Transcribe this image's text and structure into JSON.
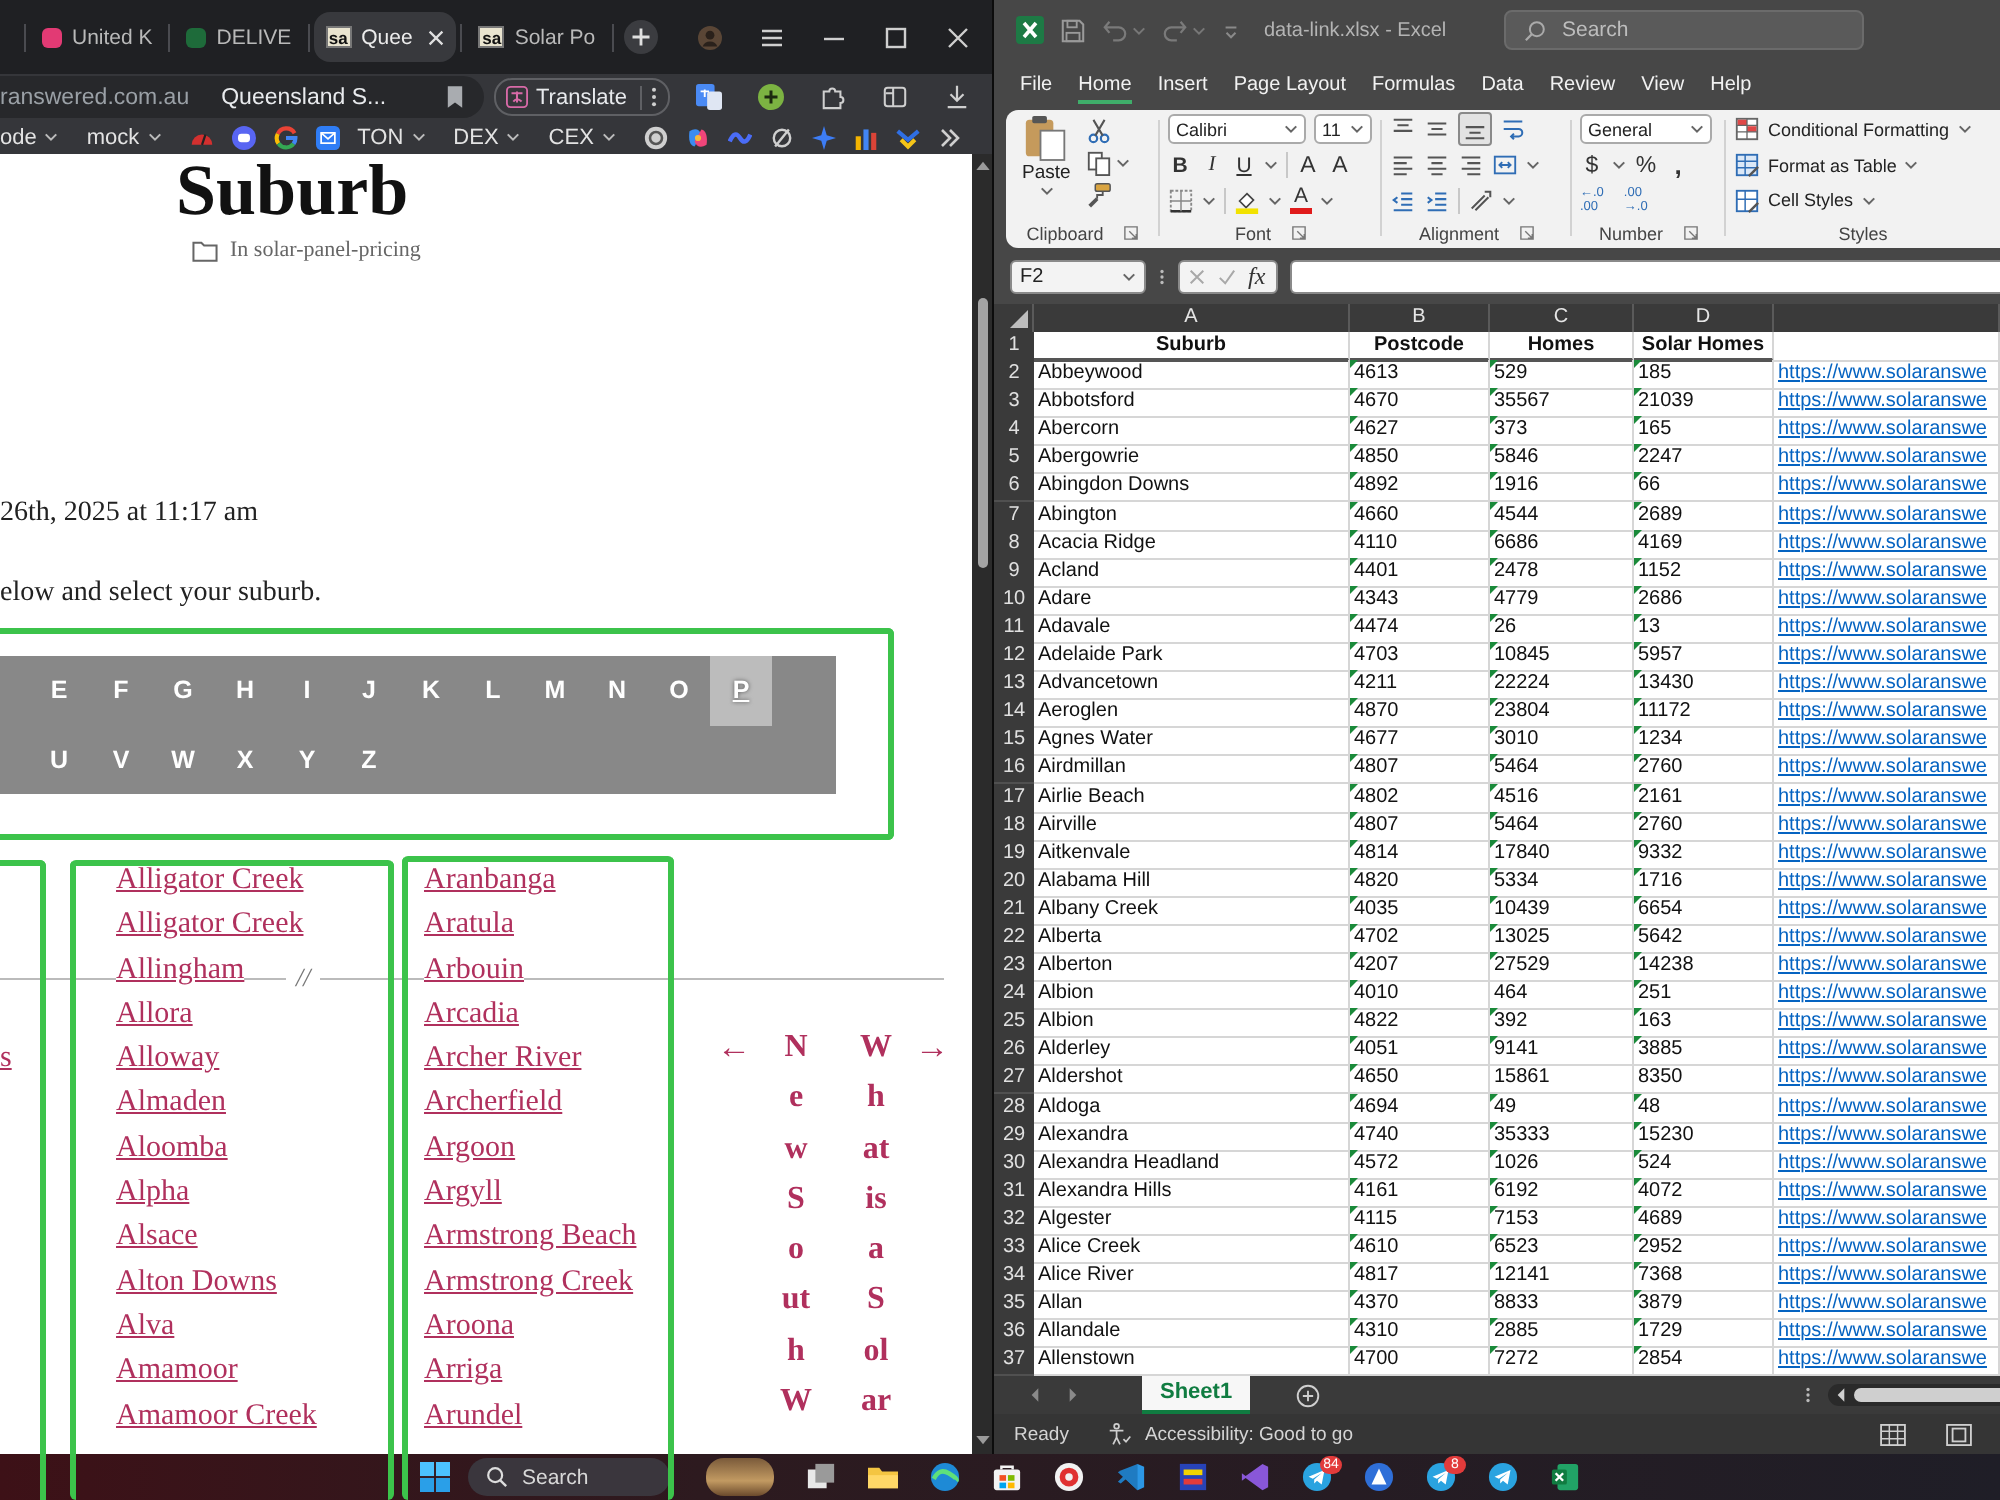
{
  "browser": {
    "tabs": [
      {
        "title": "United K",
        "selected": false,
        "favicon": {
          "kind": "tile",
          "color": "#e23a74"
        }
      },
      {
        "title": "DELIVE",
        "selected": false,
        "favicon": {
          "kind": "tile",
          "color": "#1e6b3a"
        }
      },
      {
        "title": "Quee",
        "selected": true,
        "favicon": {
          "kind": "logo",
          "text": "sa"
        }
      },
      {
        "title": "Solar Po",
        "selected": false,
        "favicon": {
          "kind": "logo",
          "text": "sa"
        }
      }
    ],
    "address": {
      "domain": "ranswered.com.au",
      "title": "Queensland S..."
    },
    "translate": "Translate",
    "bookmarks": [
      {
        "kind": "folder",
        "label": "ode"
      },
      {
        "kind": "folder",
        "label": "mock"
      },
      {
        "kind": "gauge"
      },
      {
        "kind": "chat"
      },
      {
        "kind": "ring"
      },
      {
        "kind": "mail"
      },
      {
        "kind": "folder",
        "label": "TON"
      },
      {
        "kind": "folder",
        "label": "DEX"
      },
      {
        "kind": "folder",
        "label": "CEX"
      },
      {
        "kind": "disc"
      },
      {
        "kind": "swirl"
      },
      {
        "kind": "wave"
      },
      {
        "kind": "slash"
      },
      {
        "kind": "sparkle"
      },
      {
        "kind": "bars"
      },
      {
        "kind": "chevron"
      },
      {
        "kind": "more"
      }
    ]
  },
  "page": {
    "heading": "Suburb",
    "category": "In solar-panel-pricing",
    "date": "26th, 2025 at 11:17 am",
    "instruction": "elow and select your suburb.",
    "alphabet": [
      [
        {
          "letter": "E",
          "selected": false
        },
        {
          "letter": "F",
          "selected": false
        },
        {
          "letter": "G",
          "selected": false
        },
        {
          "letter": "H",
          "selected": false
        },
        {
          "letter": "I",
          "selected": false
        },
        {
          "letter": "J",
          "selected": false
        },
        {
          "letter": "K",
          "selected": false
        },
        {
          "letter": "L",
          "selected": false
        },
        {
          "letter": "M",
          "selected": false
        },
        {
          "letter": "N",
          "selected": false
        },
        {
          "letter": "O",
          "selected": false
        },
        {
          "letter": "P",
          "selected": true
        }
      ],
      [
        {
          "letter": "U",
          "selected": false
        },
        {
          "letter": "V",
          "selected": false
        },
        {
          "letter": "W",
          "selected": false
        },
        {
          "letter": "X",
          "selected": false
        },
        {
          "letter": "Y",
          "selected": false
        },
        {
          "letter": "Z",
          "selected": false
        }
      ]
    ],
    "columns": [
      [
        "s"
      ],
      [
        "Alligator Creek",
        "Alligator Creek",
        "Allingham",
        "Allora",
        "Alloway",
        "Almaden",
        "Aloomba",
        "Alpha",
        "Alsace",
        "Alton Downs",
        "Alva",
        "Amamoor",
        "Amamoor Creek"
      ],
      [
        "Aranbanga",
        "Aratula",
        "Arbouin",
        "Arcadia",
        "Archer River",
        "Archerfield",
        "Argoon",
        "Argyll",
        "Armstrong Beach",
        "Armstrong Creek",
        "Aroona",
        "Arriga",
        "Arundel"
      ]
    ],
    "separator": "//",
    "prev": {
      "arrow": "←",
      "lines": [
        "N",
        "e",
        "w",
        "S",
        "o",
        "ut",
        "h",
        "W"
      ]
    },
    "next": {
      "lines": [
        "W",
        "h",
        "at",
        "is",
        "a",
        "S",
        "ol",
        "ar"
      ],
      "arrow": "→"
    }
  },
  "excel": {
    "title": "data-link.xlsx - Excel",
    "search": {
      "placeholder": "Search"
    },
    "menu": [
      {
        "label": "File",
        "selected": false
      },
      {
        "label": "Home",
        "selected": true
      },
      {
        "label": "Insert",
        "selected": false
      },
      {
        "label": "Page Layout",
        "selected": false
      },
      {
        "label": "Formulas",
        "selected": false
      },
      {
        "label": "Data",
        "selected": false
      },
      {
        "label": "Review",
        "selected": false
      },
      {
        "label": "View",
        "selected": false
      },
      {
        "label": "Help",
        "selected": false
      }
    ],
    "ribbon": {
      "paste": "Paste",
      "font_name": "Calibri",
      "font_size": "11",
      "style_buttons": [
        "B",
        "I",
        "U"
      ],
      "size_buttons": [
        "A",
        "A"
      ],
      "font_color": "A",
      "number_format": "General",
      "currency": "$",
      "percent": "%",
      "comma": ",",
      "decimals": [
        [
          "←.0",
          ".00"
        ],
        [
          ".00",
          "→.0"
        ]
      ],
      "styles": [
        "Conditional Formatting",
        "Format as Table",
        "Cell Styles"
      ],
      "groups": [
        "Clipboard",
        "Font",
        "Alignment",
        "Number",
        "Styles"
      ]
    },
    "name_box": "F2",
    "fx": "fx",
    "column_headers": [
      "A",
      "B",
      "C",
      "D"
    ],
    "header": {
      "n": "1",
      "cells": [
        "Suburb",
        "Postcode",
        "Homes",
        "Solar Homes"
      ]
    },
    "rows": [
      {
        "n": "2",
        "cells": [
          "Abbeywood",
          "4613",
          "529",
          "185"
        ],
        "marks": [
          true,
          true,
          true
        ],
        "link": "https://www.solaranswe"
      },
      {
        "n": "3",
        "cells": [
          "Abbotsford",
          "4670",
          "35567",
          "21039"
        ],
        "marks": [
          true,
          true,
          true
        ],
        "link": "https://www.solaranswe"
      },
      {
        "n": "4",
        "cells": [
          "Abercorn",
          "4627",
          "373",
          "165"
        ],
        "marks": [
          true,
          true,
          true
        ],
        "link": "https://www.solaranswe"
      },
      {
        "n": "5",
        "cells": [
          "Abergowrie",
          "4850",
          "5846",
          "2247"
        ],
        "marks": [
          true,
          true,
          true
        ],
        "link": "https://www.solaranswe"
      },
      {
        "n": "6",
        "cells": [
          "Abingdon Downs",
          "4892",
          "1916",
          "66"
        ],
        "marks": [
          true,
          true,
          true
        ],
        "link": "https://www.solaranswe"
      },
      {
        "n": "7",
        "cells": [
          "Abington",
          "4660",
          "4544",
          "2689"
        ],
        "marks": [
          true,
          true,
          true
        ],
        "link": "https://www.solaranswe"
      },
      {
        "n": "8",
        "cells": [
          "Acacia Ridge",
          "4110",
          "6686",
          "4169"
        ],
        "marks": [
          true,
          true,
          true
        ],
        "link": "https://www.solaranswe"
      },
      {
        "n": "9",
        "cells": [
          "Acland",
          "4401",
          "2478",
          "1152"
        ],
        "marks": [
          true,
          true,
          true
        ],
        "link": "https://www.solaranswe"
      },
      {
        "n": "10",
        "cells": [
          "Adare",
          "4343",
          "4779",
          "2686"
        ],
        "marks": [
          true,
          true,
          true
        ],
        "link": "https://www.solaranswe"
      },
      {
        "n": "11",
        "cells": [
          "Adavale",
          "4474",
          "26",
          "13"
        ],
        "marks": [
          true,
          true,
          true
        ],
        "link": "https://www.solaranswe"
      },
      {
        "n": "12",
        "cells": [
          "Adelaide Park",
          "4703",
          "10845",
          "5957"
        ],
        "marks": [
          true,
          true,
          true
        ],
        "link": "https://www.solaranswe"
      },
      {
        "n": "13",
        "cells": [
          "Advancetown",
          "4211",
          "22224",
          "13430"
        ],
        "marks": [
          true,
          true,
          true
        ],
        "link": "https://www.solaranswe"
      },
      {
        "n": "14",
        "cells": [
          "Aeroglen",
          "4870",
          "23804",
          "11172"
        ],
        "marks": [
          true,
          true,
          true
        ],
        "link": "https://www.solaranswe"
      },
      {
        "n": "15",
        "cells": [
          "Agnes Water",
          "4677",
          "3010",
          "1234"
        ],
        "marks": [
          true,
          true,
          true
        ],
        "link": "https://www.solaranswe"
      },
      {
        "n": "16",
        "cells": [
          "Airdmillan",
          "4807",
          "5464",
          "2760"
        ],
        "marks": [
          true,
          true,
          true
        ],
        "link": "https://www.solaranswe"
      },
      {
        "n": "17",
        "cells": [
          "Airlie Beach",
          "4802",
          "4516",
          "2161"
        ],
        "marks": [
          true,
          true,
          true
        ],
        "link": "https://www.solaranswe"
      },
      {
        "n": "18",
        "cells": [
          "Airville",
          "4807",
          "5464",
          "2760"
        ],
        "marks": [
          true,
          true,
          true
        ],
        "link": "https://www.solaranswe"
      },
      {
        "n": "19",
        "cells": [
          "Aitkenvale",
          "4814",
          "17840",
          "9332"
        ],
        "marks": [
          true,
          true,
          true
        ],
        "link": "https://www.solaranswe"
      },
      {
        "n": "20",
        "cells": [
          "Alabama Hill",
          "4820",
          "5334",
          "1716"
        ],
        "marks": [
          true,
          true,
          true
        ],
        "link": "https://www.solaranswe"
      },
      {
        "n": "21",
        "cells": [
          "Albany Creek",
          "4035",
          "10439",
          "6654"
        ],
        "marks": [
          true,
          true,
          true
        ],
        "link": "https://www.solaranswe"
      },
      {
        "n": "22",
        "cells": [
          "Alberta",
          "4702",
          "13025",
          "5642"
        ],
        "marks": [
          true,
          true,
          true
        ],
        "link": "https://www.solaranswe"
      },
      {
        "n": "23",
        "cells": [
          "Alberton",
          "4207",
          "27529",
          "14238"
        ],
        "marks": [
          true,
          true,
          true
        ],
        "link": "https://www.solaranswe"
      },
      {
        "n": "24",
        "cells": [
          "Albion",
          "4010",
          "464",
          "251"
        ],
        "marks": [
          true,
          false,
          true
        ],
        "link": "https://www.solaranswe"
      },
      {
        "n": "25",
        "cells": [
          "Albion",
          "4822",
          "392",
          "163"
        ],
        "marks": [
          true,
          true,
          true
        ],
        "link": "https://www.solaranswe"
      },
      {
        "n": "26",
        "cells": [
          "Alderley",
          "4051",
          "9141",
          "3885"
        ],
        "marks": [
          true,
          true,
          true
        ],
        "link": "https://www.solaranswe"
      },
      {
        "n": "27",
        "cells": [
          "Aldershot",
          "4650",
          "15861",
          "8350"
        ],
        "marks": [
          true,
          false,
          false
        ],
        "link": "https://www.solaranswe"
      },
      {
        "n": "28",
        "cells": [
          "Aldoga",
          "4694",
          "49",
          "48"
        ],
        "marks": [
          true,
          true,
          true
        ],
        "link": "https://www.solaranswe"
      },
      {
        "n": "29",
        "cells": [
          "Alexandra",
          "4740",
          "35333",
          "15230"
        ],
        "marks": [
          true,
          true,
          true
        ],
        "link": "https://www.solaranswe"
      },
      {
        "n": "30",
        "cells": [
          "Alexandra Headland",
          "4572",
          "1026",
          "524"
        ],
        "marks": [
          true,
          true,
          true
        ],
        "link": "https://www.solaranswe"
      },
      {
        "n": "31",
        "cells": [
          "Alexandra Hills",
          "4161",
          "6192",
          "4072"
        ],
        "marks": [
          true,
          true,
          true
        ],
        "link": "https://www.solaranswe"
      },
      {
        "n": "32",
        "cells": [
          "Algester",
          "4115",
          "7153",
          "4689"
        ],
        "marks": [
          true,
          true,
          true
        ],
        "link": "https://www.solaranswe"
      },
      {
        "n": "33",
        "cells": [
          "Alice Creek",
          "4610",
          "6523",
          "2952"
        ],
        "marks": [
          true,
          true,
          true
        ],
        "link": "https://www.solaranswe"
      },
      {
        "n": "34",
        "cells": [
          "Alice River",
          "4817",
          "12141",
          "7368"
        ],
        "marks": [
          true,
          true,
          true
        ],
        "link": "https://www.solaranswe"
      },
      {
        "n": "35",
        "cells": [
          "Allan",
          "4370",
          "8833",
          "3879"
        ],
        "marks": [
          true,
          true,
          true
        ],
        "link": "https://www.solaranswe"
      },
      {
        "n": "36",
        "cells": [
          "Allandale",
          "4310",
          "2885",
          "1729"
        ],
        "marks": [
          true,
          true,
          true
        ],
        "link": "https://www.solaranswe"
      },
      {
        "n": "37",
        "cells": [
          "Allenstown",
          "4700",
          "7272",
          "2854"
        ],
        "marks": [
          true,
          true,
          true
        ],
        "link": "https://www.solaranswe"
      }
    ],
    "sheets": [
      {
        "label": "Sheet1",
        "selected": true
      }
    ],
    "status": "Ready",
    "accessibility": "Accessibility: Good to go"
  },
  "taskbar": {
    "search": {
      "placeholder": "Search"
    },
    "apps": [
      {
        "kind": "photo"
      },
      {
        "kind": "taskview"
      },
      {
        "kind": "folder"
      },
      {
        "kind": "wave"
      },
      {
        "kind": "bag"
      },
      {
        "kind": "ring"
      },
      {
        "kind": "ribbon"
      },
      {
        "kind": "panel"
      },
      {
        "kind": "angle"
      },
      {
        "kind": "plane",
        "badge": "84"
      },
      {
        "kind": "triangle"
      },
      {
        "kind": "plane",
        "badge": "8"
      },
      {
        "kind": "plane"
      },
      {
        "kind": "sheet"
      }
    ]
  }
}
